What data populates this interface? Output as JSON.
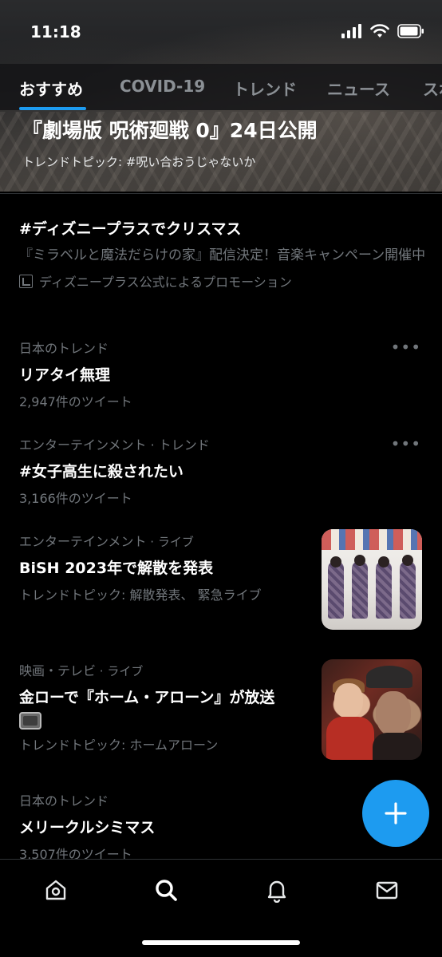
{
  "status_bar": {
    "time": "11:18"
  },
  "tabs": [
    {
      "label": "おすすめ",
      "active": true
    },
    {
      "label": "COVID-19",
      "active": false
    },
    {
      "label": "トレンド",
      "active": false
    },
    {
      "label": "ニュース",
      "active": false
    },
    {
      "label": "スポ",
      "active": false
    }
  ],
  "hero": {
    "title": "『劇場版 呪術廻戦 0』24日公開",
    "subtitle": "トレンドトピック: #呪い合おうじゃないか"
  },
  "promoted": {
    "title": "#ディズニープラスでクリスマス",
    "description": "『ミラベルと魔法だらけの家』配信決定！音楽キャンペーン開催中",
    "promoter": "ディズニープラス公式によるプロモーション"
  },
  "trends": [
    {
      "meta": "日本のトレンド",
      "title": "リアタイ無理",
      "sub": "2,947件のツイート"
    },
    {
      "meta": "エンターテインメント · トレンド",
      "title": "#女子高生に殺されたい",
      "sub": "3,166件のツイート"
    },
    {
      "meta_main": "エンターテインメント",
      "meta_tail": " · ライブ",
      "title": "BiSH 2023年で解散を発表",
      "sub": "トレンドトピック: 解散発表、 緊急ライブ"
    },
    {
      "meta_main": "映画・テレビ",
      "meta_tail": " · ライブ",
      "title": "金ローで『ホーム・アローン』が放送",
      "sub": "トレンドトピック: ホームアローン"
    },
    {
      "meta": "日本のトレンド",
      "title": "メリークルシミマス",
      "sub": "3,507件のツイート"
    }
  ],
  "more_label": "•••",
  "icons": {
    "home": "home-icon",
    "search": "search-icon",
    "notifications": "bell-icon",
    "messages": "envelope-icon",
    "compose": "plus-icon"
  },
  "colors": {
    "accent": "#1d9bf0",
    "background": "#000000",
    "secondary_text": "#71767b"
  }
}
